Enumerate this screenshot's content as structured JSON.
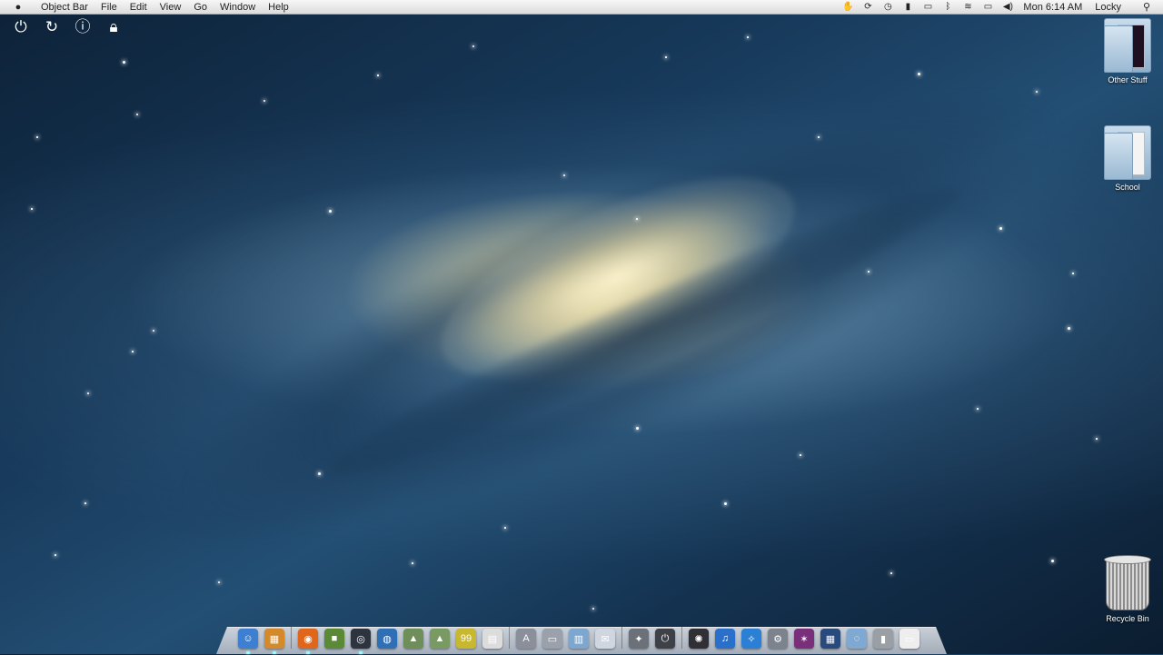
{
  "menubar": {
    "apple_icon": "apple-icon",
    "app_name": "Object Bar",
    "menus": [
      "File",
      "Edit",
      "View",
      "Go",
      "Window",
      "Help"
    ],
    "status_icons": [
      "hand-icon",
      "sync-icon",
      "time-machine-icon",
      "display-icon",
      "monitor-icon",
      "bluetooth-icon",
      "wifi-icon",
      "battery-icon",
      "volume-icon"
    ],
    "clock": "Mon 6:14 AM",
    "user": "Locky",
    "search_icon": "spotlight-icon"
  },
  "power_widgets": [
    "shutdown-icon",
    "restart-icon",
    "sleep-icon",
    "lock-icon"
  ],
  "desktop_icons": {
    "other_stuff": "Other Stuff",
    "school": "School",
    "recycle_bin": "Recycle Bin"
  },
  "dock": {
    "items": [
      {
        "name": "finder-icon",
        "glyph": "☺",
        "color": "#3d7fd1",
        "running": true
      },
      {
        "name": "windows-explorer-icon",
        "glyph": "▦",
        "color": "#d48a2b",
        "running": true
      },
      {
        "name": "sep"
      },
      {
        "name": "firefox-icon",
        "glyph": "◉",
        "color": "#e0661c",
        "running": true
      },
      {
        "name": "minecraft-icon",
        "glyph": "■",
        "color": "#5a8a36",
        "running": false
      },
      {
        "name": "steam-icon",
        "glyph": "◎",
        "color": "#2d3440",
        "running": true
      },
      {
        "name": "globe-icon",
        "glyph": "◍",
        "color": "#2f6fb5",
        "running": false
      },
      {
        "name": "photo-app-icon",
        "glyph": "▲",
        "color": "#6f8f5a",
        "running": false
      },
      {
        "name": "photo-editor-icon",
        "glyph": "▲",
        "color": "#7a9a64",
        "running": false
      },
      {
        "name": "notepad-icon",
        "glyph": "99",
        "color": "#c8b830",
        "running": false
      },
      {
        "name": "document-icon",
        "glyph": "▤",
        "color": "#dcdcdc",
        "running": false
      },
      {
        "name": "sep"
      },
      {
        "name": "app-store-icon",
        "glyph": "A",
        "color": "#8a8f99",
        "running": false
      },
      {
        "name": "scanner-icon",
        "glyph": "▭",
        "color": "#9aa1ab",
        "running": false
      },
      {
        "name": "applications-folder-icon",
        "glyph": "▥",
        "color": "#7ea7cf",
        "running": false
      },
      {
        "name": "mail-icon",
        "glyph": "✉",
        "color": "#cfd6df",
        "running": false
      },
      {
        "name": "sep"
      },
      {
        "name": "system-utility-icon",
        "glyph": "✦",
        "color": "#6c7078",
        "running": false
      },
      {
        "name": "power-button-icon",
        "glyph": "⏻",
        "color": "#3e4148",
        "running": false
      },
      {
        "name": "sep"
      },
      {
        "name": "media-player-icon",
        "glyph": "✺",
        "color": "#2f2f35",
        "running": false
      },
      {
        "name": "itunes-icon",
        "glyph": "♫",
        "color": "#2a6fc9",
        "running": false
      },
      {
        "name": "safari-icon",
        "glyph": "✧",
        "color": "#2b80d6",
        "running": false
      },
      {
        "name": "system-preferences-icon",
        "glyph": "⚙",
        "color": "#7d838c",
        "running": false
      },
      {
        "name": "photo-booth-icon",
        "glyph": "✶",
        "color": "#7a2f7a",
        "running": false
      },
      {
        "name": "mission-control-icon",
        "glyph": "▦",
        "color": "#294a7d",
        "running": false
      },
      {
        "name": "downloads-folder-icon",
        "glyph": "◌",
        "color": "#7fa9d3",
        "running": false
      },
      {
        "name": "trash-icon",
        "glyph": "▮",
        "color": "#9a9ea5",
        "running": false
      },
      {
        "name": "preview-icon",
        "glyph": "▭",
        "color": "#eeeeee",
        "running": false
      }
    ]
  }
}
